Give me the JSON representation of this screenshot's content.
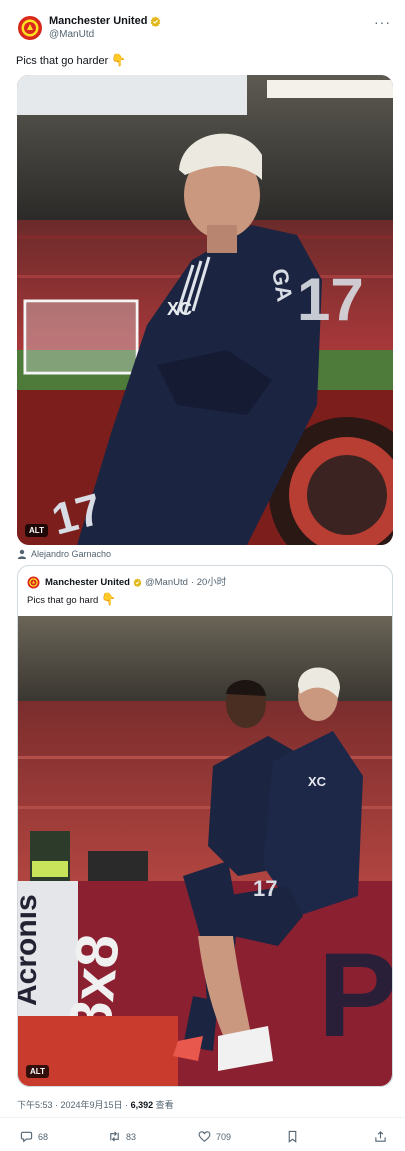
{
  "tweet": {
    "author_name": "Manchester United",
    "handle": "@ManUtd",
    "more_icon": "more-icon",
    "text": "Pics that go harder",
    "emoji": "👇",
    "photo_alt_badge": "ALT",
    "tagged_user": "Alejandro Garnacho"
  },
  "quoted": {
    "author_name": "Manchester United",
    "handle": "@ManUtd",
    "time": "· 20小时",
    "text": "Pics that go hard",
    "emoji": "👇",
    "photo_alt_badge": "ALT"
  },
  "meta": {
    "timestamp": "下午5:53 · 2024年9月15日 · ",
    "views_count": "6,392",
    "views_label": " 查看"
  },
  "actions": {
    "reply_count": "68",
    "retweet_count": "83",
    "like_count": "709"
  },
  "colors": {
    "kit_navy": "#1b2440",
    "stand_red": "#a3232a",
    "verified_gold": "#e2b719"
  }
}
